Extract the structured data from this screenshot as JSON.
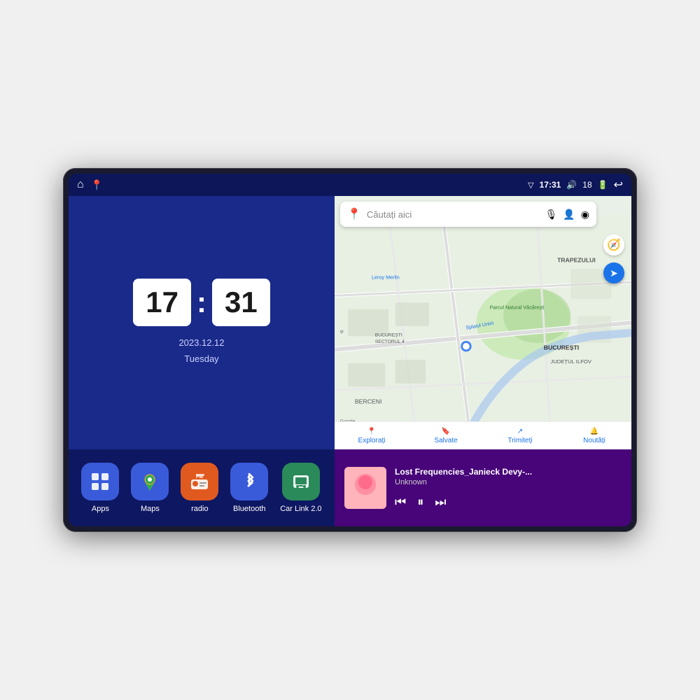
{
  "device": {
    "title": "Car Android Head Unit"
  },
  "status_bar": {
    "left_icons": [
      "home",
      "maps"
    ],
    "time": "17:31",
    "volume_label": "18",
    "battery_icon": "battery",
    "back_icon": "back",
    "signal_icon": "▽"
  },
  "clock": {
    "hour": "17",
    "minute": "31",
    "date": "2023.12.12",
    "day": "Tuesday"
  },
  "map": {
    "search_placeholder": "Căutați aici",
    "nav_items": [
      {
        "label": "Explorați",
        "icon": "📍"
      },
      {
        "label": "Salvate",
        "icon": "🔖"
      },
      {
        "label": "Trimiteți",
        "icon": "↗"
      },
      {
        "label": "Noutăți",
        "icon": "🔔"
      }
    ],
    "locations": [
      "TRAPEZULUI",
      "BUCUREȘTI",
      "JUDEȚUL ILFOV",
      "BERCENI",
      "Splaiul Unirii",
      "Parcul Natural Văcărești",
      "Leroy Merlin",
      "BUCUREȘTI SECTORUL 4"
    ]
  },
  "apps": [
    {
      "id": "apps",
      "label": "Apps",
      "icon": "⊞",
      "color": "#3a5bd9"
    },
    {
      "id": "maps",
      "label": "Maps",
      "icon": "📍",
      "color": "#3a5bd9"
    },
    {
      "id": "radio",
      "label": "radio",
      "icon": "📻",
      "color": "#e05a20"
    },
    {
      "id": "bluetooth",
      "label": "Bluetooth",
      "icon": "⚡",
      "color": "#3a5bd9"
    },
    {
      "id": "carlink",
      "label": "Car Link 2.0",
      "icon": "📱",
      "color": "#2a8a5a"
    }
  ],
  "music": {
    "title": "Lost Frequencies_Janieck Devy-...",
    "artist": "Unknown",
    "prev_label": "⏮",
    "play_label": "⏸",
    "next_label": "⏭"
  }
}
